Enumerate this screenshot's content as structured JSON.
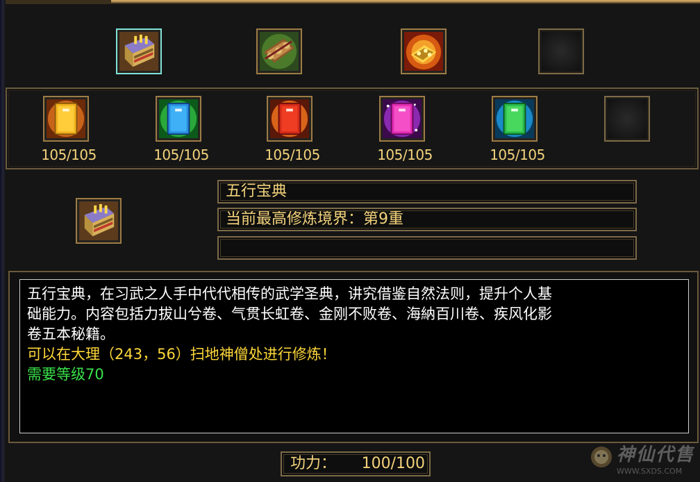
{
  "top_row": {
    "slots": [
      {
        "icon": "wuxing-book-icon",
        "selected": true
      },
      {
        "icon": "scroll-chest-icon",
        "selected": false
      },
      {
        "icon": "golden-treasure-icon",
        "selected": false
      },
      {
        "icon": "empty-slot-icon",
        "selected": false
      }
    ]
  },
  "volume_row": {
    "volumes": [
      {
        "icon": "yellow-volume-icon",
        "progress": "105/105"
      },
      {
        "icon": "blue-volume-icon",
        "progress": "105/105"
      },
      {
        "icon": "red-volume-icon",
        "progress": "105/105"
      },
      {
        "icon": "purple-volume-icon",
        "progress": "105/105"
      },
      {
        "icon": "green-volume-icon",
        "progress": "105/105"
      },
      {
        "icon": "empty-slot-icon",
        "progress": ""
      }
    ]
  },
  "detail": {
    "icon": "wuxing-book-icon",
    "name": "五行宝典",
    "realm": "当前最高修炼境界：第9重",
    "extra": ""
  },
  "description": {
    "lines": [
      "五行宝典，在习武之人手中代代相传的武学圣典，讲究借鉴自然法则，提升个人基",
      "础能力。内容包括力拔山兮卷、气贯长虹卷、金刚不败卷、海納百川卷、疾风化影",
      "卷五本秘籍。"
    ],
    "location_hint": "可以在大理（243，56）扫地神僧处进行修炼！",
    "level_requirement": "需要等级70"
  },
  "power": {
    "label": "功力：",
    "value": "100/100"
  },
  "watermark": {
    "text": "神仙代售",
    "url": "WWW.SXDS.COM"
  }
}
